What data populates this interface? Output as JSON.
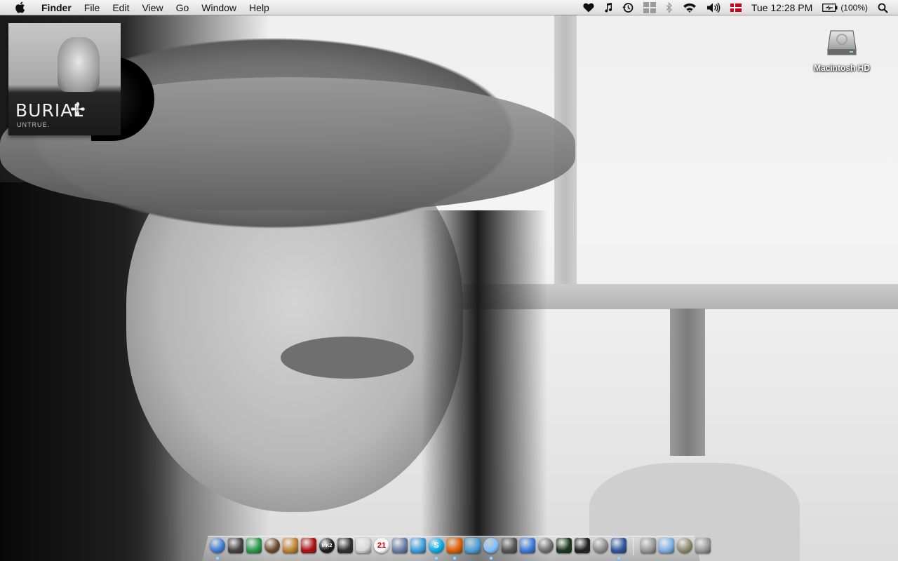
{
  "menubar": {
    "apple_icon": "apple-logo-icon",
    "app_name": "Finder",
    "menus": [
      "File",
      "Edit",
      "View",
      "Go",
      "Window",
      "Help"
    ],
    "status": {
      "clock": "Tue 12:28 PM",
      "battery": "(100%)",
      "icons": [
        "heart-icon",
        "music-note-icon",
        "time-machine-icon",
        "spaces-icon",
        "bluetooth-icon",
        "wifi-icon",
        "volume-icon",
        "danish-flag-icon",
        "battery-icon",
        "spotlight-icon"
      ]
    }
  },
  "album": {
    "title": "BURIAL",
    "subtitle": "UNTRUE."
  },
  "desktop": {
    "icons": [
      {
        "label": "Macintosh HD",
        "icon": "hard-drive-icon"
      }
    ]
  },
  "dock": {
    "apps": [
      {
        "name": "finder-icon",
        "color": "#3a7bd5",
        "running": true
      },
      {
        "name": "dashboard-icon",
        "color": "#444444",
        "running": false
      },
      {
        "name": "sims-icon",
        "color": "#2a9d4b",
        "running": false
      },
      {
        "name": "game-icon",
        "color": "#6b4a2a",
        "running": false
      },
      {
        "name": "guitar-icon",
        "color": "#c0842f",
        "running": false
      },
      {
        "name": "record-app-icon",
        "color": "#b01010",
        "running": false
      },
      {
        "name": "mk2-app-icon",
        "color": "#1a1a1a",
        "running": false,
        "text": "MK2"
      },
      {
        "name": "clapper-icon",
        "color": "#303030",
        "running": false
      },
      {
        "name": "scripting-app-icon",
        "color": "#d8d8d8",
        "running": false
      },
      {
        "name": "ical-icon",
        "color": "#ffffff",
        "running": false,
        "text": "21"
      },
      {
        "name": "address-book-icon",
        "color": "#6a7fa8",
        "running": false
      },
      {
        "name": "messenger-icon",
        "color": "#3aa0e0",
        "running": false
      },
      {
        "name": "skype-icon",
        "color": "#00aff0",
        "running": true,
        "text": "S"
      },
      {
        "name": "firefox-icon",
        "color": "#e66000",
        "running": true
      },
      {
        "name": "safari-icon",
        "color": "#4aa3df",
        "running": false
      },
      {
        "name": "itunes-icon",
        "color": "#7cc0ff",
        "running": true
      },
      {
        "name": "preview-icon",
        "color": "#555555",
        "running": false
      },
      {
        "name": "word-app-icon",
        "color": "#3c7ae0",
        "running": false
      },
      {
        "name": "photo-booth-icon",
        "color": "#6e6e6e",
        "running": false
      },
      {
        "name": "activity-monitor-icon",
        "color": "#1c3a1c",
        "running": false
      },
      {
        "name": "terminal-icon",
        "color": "#222222",
        "running": false
      },
      {
        "name": "system-preferences-icon",
        "color": "#8a8a8a",
        "running": false
      },
      {
        "name": "photo-app-icon",
        "color": "#3057a0",
        "running": true
      }
    ],
    "right_items": [
      {
        "name": "downloads-stack-icon",
        "color": "#9a9a9a"
      },
      {
        "name": "applications-folder-icon",
        "color": "#7fb2e8"
      },
      {
        "name": "documents-stack-icon",
        "color": "#8a8a6a"
      },
      {
        "name": "trash-icon",
        "color": "#9a9a9a"
      }
    ]
  }
}
